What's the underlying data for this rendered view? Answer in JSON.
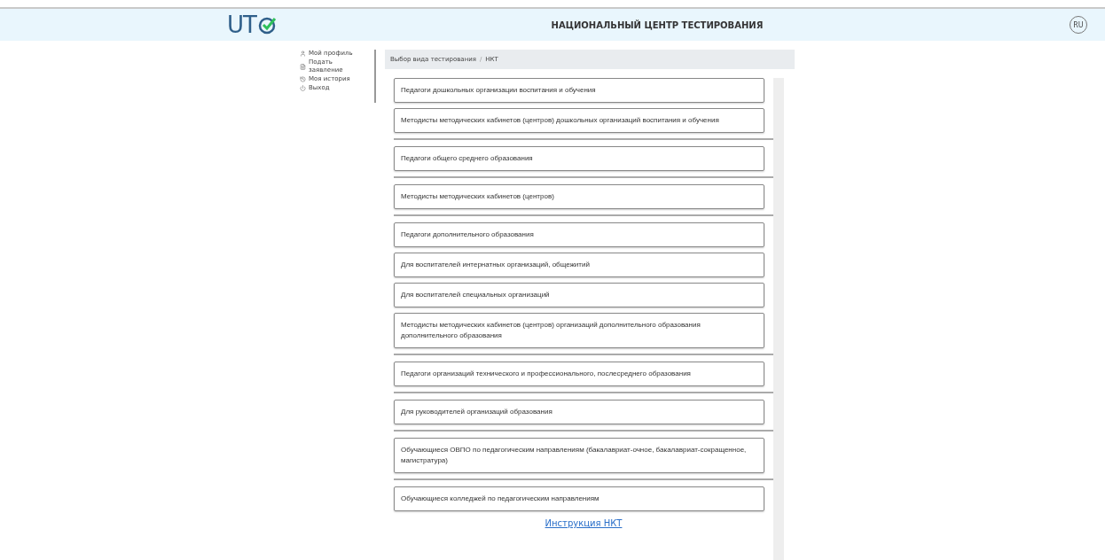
{
  "header": {
    "logo": "UT",
    "title": "НАЦИОНАЛЬНЫЙ ЦЕНТР ТЕСТИРОВАНИЯ",
    "language": "RU"
  },
  "sidebar": {
    "items": [
      {
        "kind": "profile",
        "label": "Мой профиль"
      },
      {
        "kind": "application",
        "label": "Подать заявление"
      },
      {
        "kind": "history",
        "label": "Моя история"
      },
      {
        "kind": "logout",
        "label": "Выход"
      }
    ]
  },
  "breadcrumb": {
    "items": [
      "Выбор вида тестирования",
      "НКТ"
    ],
    "separator": "/"
  },
  "groups": [
    {
      "options": [
        "Педагоги дошкольных организации воспитания и обучения",
        "Методисты методических кабинетов (центров) дошкольных организаций воспитания и обучения"
      ]
    },
    {
      "options": [
        "Педагоги общего среднего образования"
      ]
    },
    {
      "options": [
        "Методисты методических кабинетов (центров)"
      ]
    },
    {
      "options": [
        "Педагоги дополнительного образования",
        "Для воспитателей интернатных организаций, общежитий",
        "Для воспитателей специальных организаций",
        "Методисты методических кабинетов (центров) организаций дополнительного образования дополнительного образования"
      ]
    },
    {
      "options": [
        "Педагоги организаций технического и профессионального, послесреднего образования"
      ]
    },
    {
      "options": [
        "Для руководителей организаций образования"
      ]
    },
    {
      "options": [
        "Обучающиеся ОВПО по педагогическим направлениям (бакалавриат-очное, бакалавриат-сокращенное, магистратура)"
      ]
    },
    {
      "options": [
        "Обучающиеся колледжей по педагогическим направлениям"
      ]
    }
  ],
  "footer_link": "Инструкция НКТ"
}
